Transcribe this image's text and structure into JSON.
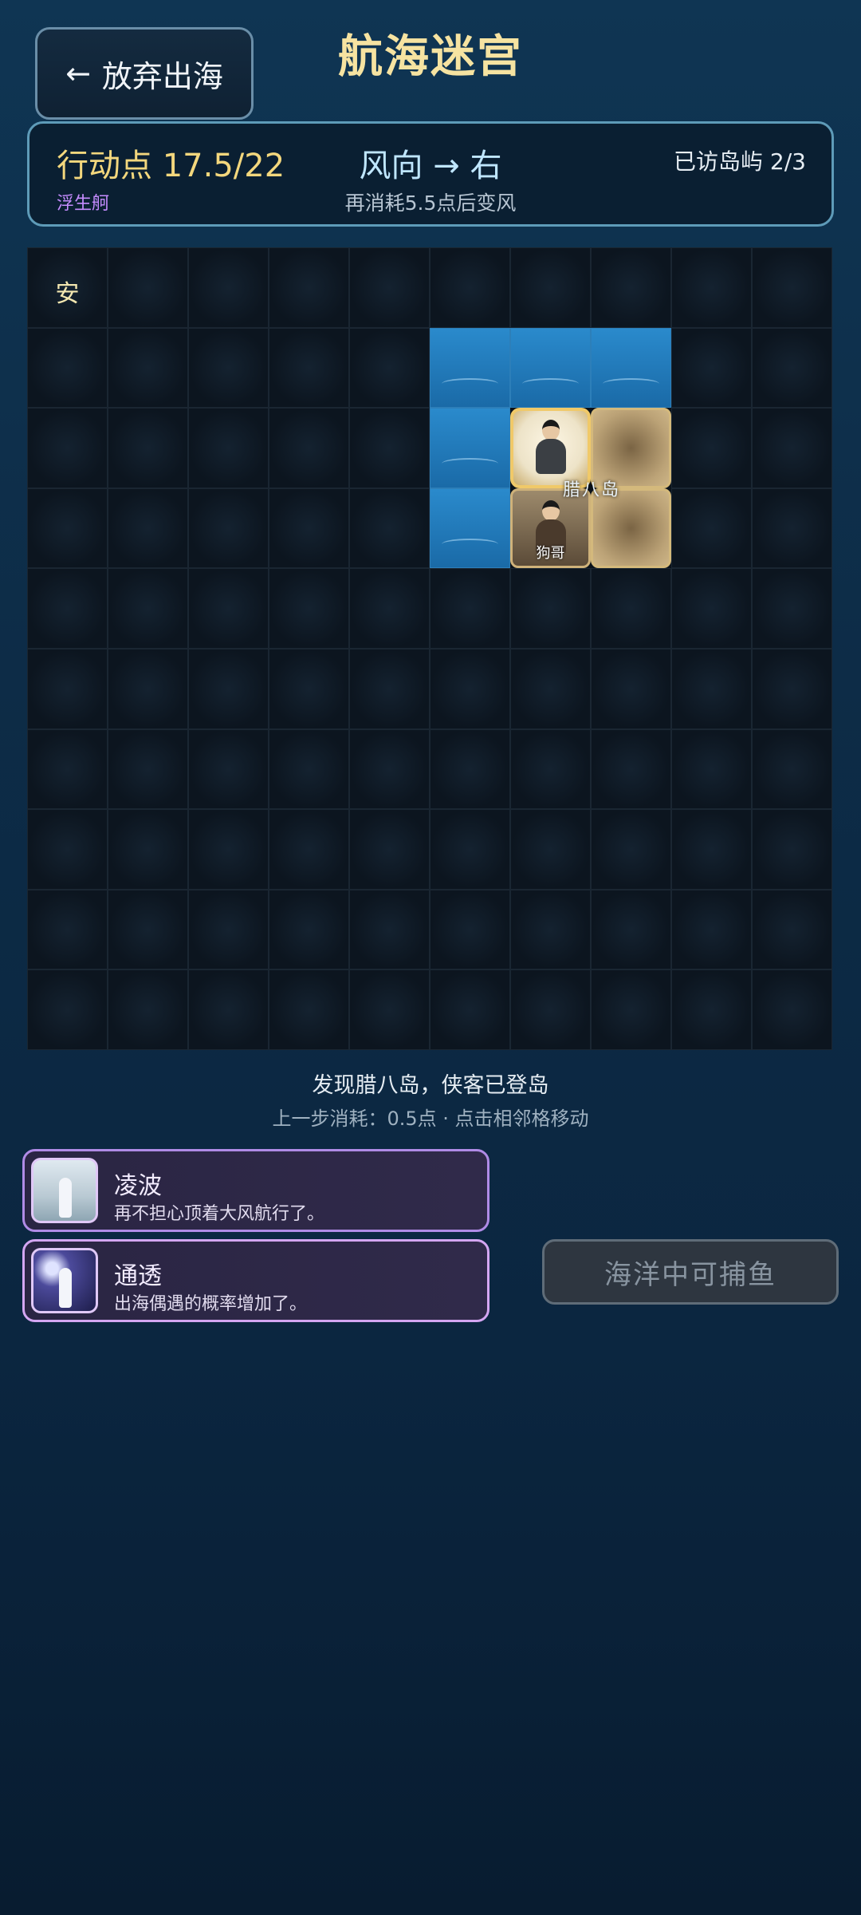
{
  "header": {
    "back_label": "放弃出海",
    "title": "航海迷宫"
  },
  "status": {
    "action_points": "行动点 17.5/22",
    "wind": "风向 → 右",
    "visited": "已访岛屿 2/3",
    "boat": "浮生舸",
    "wind_change_note": "再消耗5.5点后变风"
  },
  "map": {
    "rows": 10,
    "cols": 10,
    "safe_label": "安",
    "island_label": "腊八岛",
    "npc_name": "狗哥",
    "cells": [
      {
        "row": 0,
        "col": 0,
        "kind": "safe"
      },
      {
        "row": 1,
        "col": 5,
        "kind": "sea"
      },
      {
        "row": 1,
        "col": 6,
        "kind": "sea"
      },
      {
        "row": 1,
        "col": 7,
        "kind": "sea"
      },
      {
        "row": 2,
        "col": 5,
        "kind": "sea"
      },
      {
        "row": 2,
        "col": 6,
        "kind": "hero"
      },
      {
        "row": 2,
        "col": 7,
        "kind": "sand"
      },
      {
        "row": 3,
        "col": 5,
        "kind": "sea"
      },
      {
        "row": 3,
        "col": 6,
        "kind": "npc"
      },
      {
        "row": 3,
        "col": 7,
        "kind": "sand"
      }
    ]
  },
  "messages": {
    "event": "发现腊八岛，侠客已登岛",
    "hint": "上一步消耗：0.5点 · 点击相邻格移动"
  },
  "skills": [
    {
      "name": "凌波",
      "desc": "再不担心顶着大风航行了。"
    },
    {
      "name": "通透",
      "desc": "出海偶遇的概率增加了。"
    }
  ],
  "fish_button": "海洋中可捕鱼",
  "colors": {
    "title": "#f6e3a1",
    "action_points": "#f3d77d",
    "boat": "#c58cff",
    "sea": "#2a8acc"
  }
}
